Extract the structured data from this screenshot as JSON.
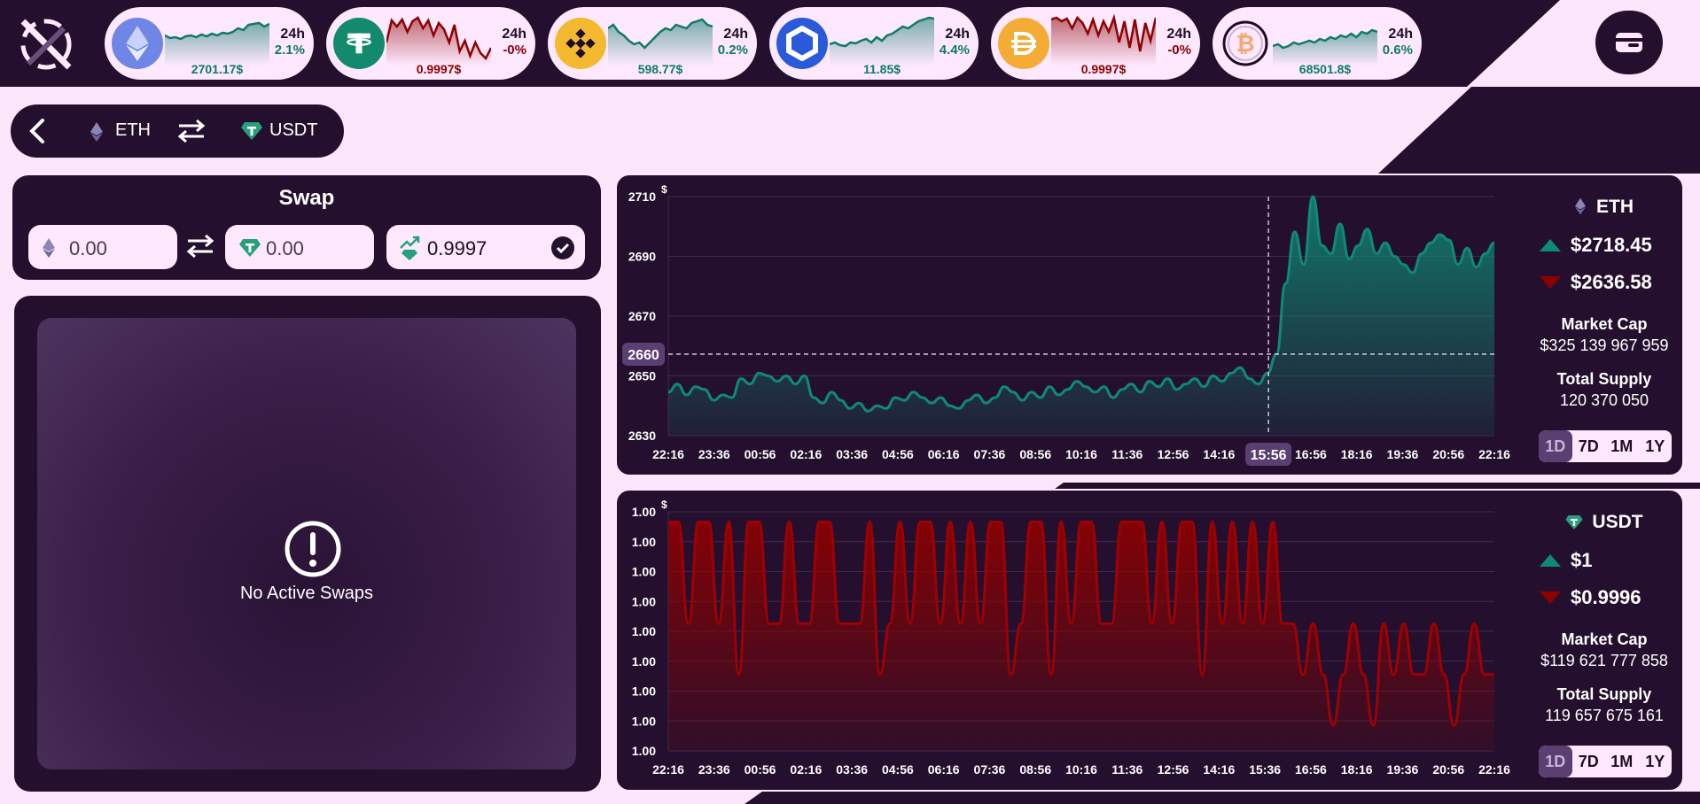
{
  "tickers": [
    {
      "symbol": "ETH",
      "period": "24h",
      "change": "2.1%",
      "price": "2701.17$",
      "trend": "up",
      "spark": [
        22,
        25,
        24,
        26,
        23,
        22,
        24,
        21,
        23,
        20,
        22,
        19,
        20,
        18,
        14,
        16,
        10,
        9,
        8,
        12,
        9
      ],
      "icon": "ethereum-icon"
    },
    {
      "symbol": "USDT",
      "period": "24h",
      "change": "-0%",
      "price": "0.9997$",
      "trend": "down",
      "spark": [
        30,
        5,
        12,
        4,
        18,
        6,
        2,
        14,
        5,
        22,
        8,
        15,
        30,
        10,
        40,
        28,
        45,
        30,
        42,
        48,
        36
      ],
      "icon": "tether-icon"
    },
    {
      "symbol": "BNB",
      "period": "24h",
      "change": "0.2%",
      "price": "598.77$",
      "trend": "up",
      "spark": [
        14,
        10,
        18,
        22,
        28,
        32,
        30,
        36,
        30,
        24,
        18,
        14,
        16,
        10,
        12,
        14,
        8,
        6,
        4,
        10,
        12
      ],
      "icon": "bnb-icon"
    },
    {
      "symbol": "LINK",
      "period": "24h",
      "change": "4.4%",
      "price": "11.85$",
      "trend": "up",
      "spark": [
        32,
        30,
        33,
        34,
        30,
        31,
        28,
        26,
        30,
        24,
        28,
        22,
        20,
        16,
        12,
        14,
        10,
        6,
        4,
        2,
        3
      ],
      "icon": "chainlink-icon"
    },
    {
      "symbol": "DAI",
      "period": "24h",
      "change": "-0%",
      "price": "0.9997$",
      "trend": "down",
      "spark": [
        4,
        2,
        6,
        3,
        14,
        2,
        8,
        20,
        4,
        22,
        6,
        18,
        2,
        30,
        6,
        36,
        4,
        40,
        8,
        28,
        2
      ],
      "icon": "dai-icon"
    },
    {
      "symbol": "BTC",
      "period": "24h",
      "change": "0.6%",
      "price": "68501.8$",
      "trend": "up",
      "spark": [
        34,
        32,
        36,
        34,
        30,
        32,
        30,
        28,
        30,
        26,
        28,
        24,
        26,
        22,
        24,
        20,
        24,
        18,
        20,
        16,
        18
      ],
      "icon": "bitcoin-icon"
    }
  ],
  "pair": {
    "from": "ETH",
    "to": "USDT"
  },
  "swap": {
    "title": "Swap",
    "from_value": "0.00",
    "to_value": "0.00",
    "rate": "0.9997"
  },
  "empty_state": {
    "message": "No Active Swaps"
  },
  "colors": {
    "up": "#0e7a6a",
    "down": "#8e0000",
    "panel": "#24102e",
    "bg": "#fbe6fb"
  },
  "range_options": [
    "1D",
    "7D",
    "1M",
    "1Y"
  ],
  "eth_panel": {
    "name": "ETH",
    "high": "$2718.45",
    "low": "$2636.58",
    "market_cap_label": "Market Cap",
    "market_cap": "$325 139 967 959",
    "total_supply_label": "Total Supply",
    "total_supply": "120 370 050",
    "selected_range": "1D",
    "crosshair_y": "2660",
    "crosshair_x": "15:56",
    "y_unit": "$"
  },
  "usdt_panel": {
    "name": "USDT",
    "high": "$1",
    "low": "$0.9996",
    "market_cap_label": "Market Cap",
    "market_cap": "$119 621 777 858",
    "total_supply_label": "Total Supply",
    "total_supply": "119 657 675 161",
    "selected_range": "1D",
    "y_unit": "$"
  },
  "chart_data": [
    {
      "type": "area",
      "title": "ETH",
      "x_ticks": [
        "22:16",
        "23:36",
        "00:56",
        "02:16",
        "03:36",
        "04:56",
        "06:16",
        "07:36",
        "08:56",
        "10:16",
        "11:36",
        "12:56",
        "14:16",
        "15:36",
        "16:56",
        "18:16",
        "19:36",
        "20:56",
        "22:16"
      ],
      "y_ticks": [
        2630,
        2650,
        2670,
        2690,
        2710
      ],
      "ylim": [
        2630,
        2718
      ],
      "values": [
        2646,
        2649,
        2645,
        2648,
        2647,
        2643,
        2645,
        2644,
        2651,
        2649,
        2653,
        2652,
        2650,
        2652,
        2649,
        2652,
        2644,
        2642,
        2646,
        2643,
        2640,
        2642,
        2639,
        2641,
        2640,
        2644,
        2643,
        2646,
        2644,
        2642,
        2644,
        2641,
        2640,
        2643,
        2645,
        2642,
        2644,
        2648,
        2646,
        2643,
        2646,
        2644,
        2648,
        2645,
        2647,
        2650,
        2648,
        2646,
        2648,
        2644,
        2647,
        2649,
        2646,
        2650,
        2648,
        2651,
        2647,
        2649,
        2651,
        2648,
        2652,
        2650,
        2653,
        2655,
        2651,
        2649,
        2653,
        2660,
        2686,
        2705,
        2693,
        2718,
        2700,
        2697,
        2708,
        2695,
        2700,
        2706,
        2697,
        2701,
        2696,
        2693,
        2690,
        2697,
        2701,
        2704,
        2702,
        2693,
        2699,
        2692,
        2697,
        2701
      ],
      "grid": true
    },
    {
      "type": "area",
      "title": "USDT",
      "x_ticks": [
        "22:16",
        "23:36",
        "00:56",
        "02:16",
        "03:36",
        "04:56",
        "06:16",
        "07:36",
        "08:56",
        "10:16",
        "11:36",
        "12:56",
        "14:16",
        "15:36",
        "16:56",
        "18:16",
        "19:36",
        "20:56",
        "22:16"
      ],
      "y_ticks": [
        "1.00",
        "1.00",
        "1.00",
        "1.00",
        "1.00",
        "1.00",
        "1.00",
        "1.00",
        "1.00"
      ],
      "values": [
        1,
        1,
        0.9998,
        1,
        1,
        0.9998,
        1,
        0.9997,
        1,
        1,
        0.9998,
        0.9998,
        1,
        0.9998,
        0.9998,
        1,
        1,
        0.9998,
        0.9998,
        0.9998,
        1,
        0.9997,
        0.9998,
        1,
        0.9998,
        1,
        1,
        0.9998,
        1,
        0.9998,
        1,
        0.9998,
        1,
        1,
        0.9997,
        0.9998,
        1,
        1,
        0.9997,
        1,
        0.9998,
        1,
        1,
        0.9998,
        0.9998,
        1,
        1,
        1,
        0.9998,
        1,
        0.9998,
        1,
        1,
        0.9997,
        1,
        0.9998,
        1,
        0.9998,
        1,
        0.9998,
        1,
        0.9998,
        0.9998,
        0.9997,
        0.9998,
        0.9997,
        0.9996,
        0.9997,
        0.9998,
        0.9997,
        0.9996,
        0.9998,
        0.9997,
        0.9998,
        0.9997,
        0.9997,
        0.9998,
        0.9997,
        0.9996,
        0.9997,
        0.9998,
        0.9997,
        0.9997
      ],
      "grid": true
    }
  ]
}
